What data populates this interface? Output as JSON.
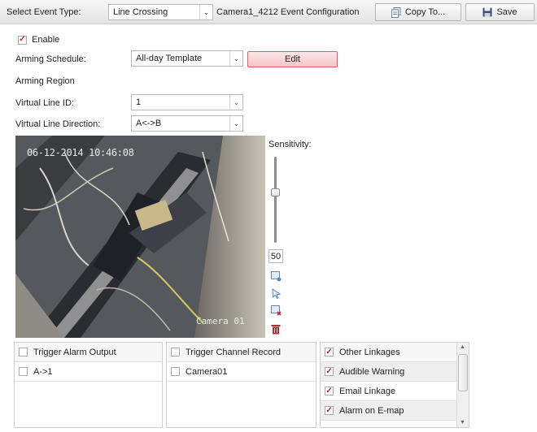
{
  "toolbar": {
    "select_event_label": "Select Event Type:",
    "event_type_value": "Line Crossing",
    "config_title": "Camera1_4212 Event Configuration",
    "copy_label": "Copy To...",
    "save_label": "Save"
  },
  "form": {
    "enable_label": "Enable",
    "enable_checked": true,
    "arming_schedule_label": "Arming Schedule:",
    "arming_schedule_value": "All-day Template",
    "edit_label": "Edit",
    "arming_region_label": "Arming Region",
    "virtual_line_id_label": "Virtual Line ID:",
    "virtual_line_id_value": "1",
    "virtual_line_direction_label": "Virtual Line Direction:",
    "virtual_line_direction_value": "A<->B"
  },
  "video": {
    "timestamp": "06-12-2014 10:46:08",
    "camera_label": "Camera 01"
  },
  "sensitivity": {
    "label": "Sensitivity:",
    "value": "50",
    "level": 0.5
  },
  "tools": [
    "draw-line-icon",
    "select-pointer-icon",
    "clear-line-icon",
    "delete-icon"
  ],
  "linkage": {
    "alarm_output": {
      "header": "Trigger Alarm Output",
      "items": [
        "A->1"
      ]
    },
    "channel_record": {
      "header": "Trigger Channel Record",
      "items": [
        "Camera01"
      ]
    },
    "other": {
      "header": "Other Linkages",
      "items": [
        {
          "label": "Audible Warning",
          "checked": true
        },
        {
          "label": "Email Linkage",
          "checked": true
        },
        {
          "label": "Alarm on E-map",
          "checked": true
        }
      ]
    }
  },
  "colors": {
    "accent_red": "#c0262d",
    "edit_button": "#f5c4c5"
  }
}
